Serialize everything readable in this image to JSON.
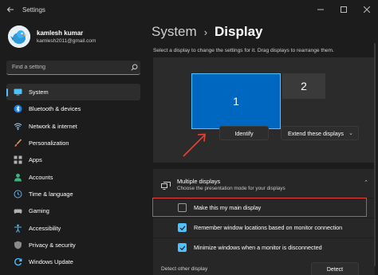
{
  "window": {
    "title": "Settings",
    "controls": [
      "minimize",
      "maximize",
      "close"
    ]
  },
  "profile": {
    "name": "kamlesh kumar",
    "email": "kamlesh2011@gmail.com"
  },
  "search": {
    "placeholder": "Find a setting"
  },
  "sidebar": {
    "items": [
      {
        "label": "System",
        "icon": "system-icon",
        "active": true
      },
      {
        "label": "Bluetooth & devices",
        "icon": "bluetooth-icon"
      },
      {
        "label": "Network & internet",
        "icon": "network-icon"
      },
      {
        "label": "Personalization",
        "icon": "brush-icon"
      },
      {
        "label": "Apps",
        "icon": "apps-icon"
      },
      {
        "label": "Accounts",
        "icon": "accounts-icon"
      },
      {
        "label": "Time & language",
        "icon": "globe-clock-icon"
      },
      {
        "label": "Gaming",
        "icon": "gaming-icon"
      },
      {
        "label": "Accessibility",
        "icon": "accessibility-icon"
      },
      {
        "label": "Privacy & security",
        "icon": "shield-icon"
      },
      {
        "label": "Windows Update",
        "icon": "windows-update-icon"
      }
    ]
  },
  "main": {
    "breadcrumb_parent": "System",
    "breadcrumb_current": "Display",
    "instructions": "Select a display to change the settings for it. Drag displays to rearrange them.",
    "monitors": [
      "1",
      "2"
    ],
    "identify_label": "Identify",
    "extend_value": "Extend these displays",
    "multiple_displays": {
      "title": "Multiple displays",
      "subtitle": "Choose the presentation mode for your displays",
      "options": [
        {
          "label": "Make this my main display",
          "checked": false
        },
        {
          "label": "Remember window locations based on monitor connection",
          "checked": true
        },
        {
          "label": "Minimize windows when a monitor is disconnected",
          "checked": true
        }
      ],
      "detect_label": "Detect other display",
      "detect_button": "Detect"
    }
  },
  "colors": {
    "accent": "#4cc2ff",
    "selected_monitor": "#0067c0",
    "annotation": "#e8433b"
  }
}
